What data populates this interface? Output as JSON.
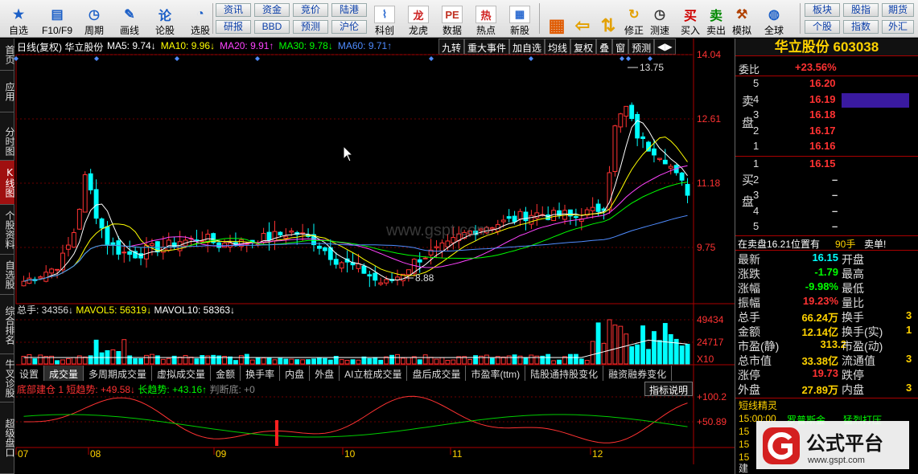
{
  "toolbar": {
    "items": [
      {
        "label": "自选",
        "icon": "star-icon"
      },
      {
        "label": "F10/F9",
        "icon": "f10-icon"
      },
      {
        "label": "周期",
        "icon": "clock-icon"
      },
      {
        "label": "画线",
        "icon": "pen-icon"
      },
      {
        "label": "论股",
        "icon": "discuss-icon"
      },
      {
        "label": "选股",
        "icon": "select-stock-icon"
      }
    ],
    "grid_buttons": [
      [
        "资讯",
        "资金",
        "竞价",
        "陆港"
      ],
      [
        "研报",
        "BBD",
        "预测",
        "沪伦"
      ]
    ],
    "items2": [
      {
        "label": "科创",
        "icon": "kechuang-icon"
      },
      {
        "label": "龙虎",
        "icon": "dragon-tiger-icon"
      },
      {
        "label": "数据",
        "icon": "data-pe-icon"
      },
      {
        "label": "热点",
        "icon": "hot-icon"
      },
      {
        "label": "新股",
        "icon": "new-stock-icon"
      }
    ],
    "items3": [
      {
        "label": "",
        "icon": "grid-icon"
      },
      {
        "label": "",
        "icon": "back-arrow-icon"
      },
      {
        "label": "",
        "icon": "up-down-icon"
      },
      {
        "label": "修正",
        "icon": "fix-icon"
      },
      {
        "label": "测速",
        "icon": "speed-icon"
      },
      {
        "label": "买入",
        "icon": "buy-icon"
      },
      {
        "label": "卖出",
        "icon": "sell-icon"
      },
      {
        "label": "模拟",
        "icon": "simulate-icon"
      },
      {
        "label": "全球",
        "icon": "globe-icon"
      }
    ],
    "grid_buttons2": [
      [
        "板块",
        "股指",
        "期货"
      ],
      [
        "个股",
        "指数",
        "外汇"
      ]
    ]
  },
  "left_tabs": [
    "首页",
    "应用",
    "分时图",
    "K线图",
    "个股资料",
    "自选股",
    "综合排名",
    "牛叉诊股",
    "超级盘口"
  ],
  "chart": {
    "title": "日线(复权)",
    "stock": "华立股份",
    "ma": [
      {
        "label": "MA5: 9.74↓",
        "color": "#ffffff"
      },
      {
        "label": "MA10: 9.96↓",
        "color": "#ffff00"
      },
      {
        "label": "MA20: 9.91↑",
        "color": "#ff44ff"
      },
      {
        "label": "MA30: 9.78↓",
        "color": "#00ff00"
      },
      {
        "label": "MA60: 9.71↑",
        "color": "#4f8cff"
      }
    ],
    "right_buttons": [
      "九转",
      "重大事件",
      "加自选",
      "均线",
      "复权",
      "叠",
      "窗",
      "预测",
      "◀▶"
    ],
    "y_labels": [
      "14.04",
      "12.61",
      "11.18",
      "9.75"
    ],
    "high_label": "13.75",
    "low_label": "8.88",
    "watermark": "www.gspt.com",
    "x_labels": [
      "07",
      "08",
      "09",
      "10",
      "11",
      "12"
    ],
    "volume_header": {
      "total": "总手: 34356↓",
      "mavol5": "MAVOL5: 56319↓",
      "mavol10": "MAVOL10: 58363↓"
    },
    "volume_labels": [
      "49434",
      "24717",
      "X10"
    ],
    "indicator_header": {
      "name": "底部建仓",
      "short": "1 短趋势: +49.58↓",
      "long": "长趋势: +43.16↑",
      "judge": "判断底: +0"
    },
    "indicator_btn": "指标说明",
    "indicator_labels": [
      "+100.2",
      "+50.89"
    ]
  },
  "bottom_tabs": [
    "设置",
    "成交量",
    "多周期成交量",
    "虚拟成交量",
    "金额",
    "换手率",
    "内盘",
    "外盘",
    "AI立桩成交量",
    "盘后成交量",
    "市盈率(ttm)",
    "陆股通持股变化",
    "融资融券变化"
  ],
  "panel": {
    "title": "华立股份 603038",
    "weibi_label": "委比",
    "weibi": "+23.56%",
    "sell_label": "卖盘",
    "buy_label": "买盘",
    "sell": [
      [
        "5",
        "16.20"
      ],
      [
        "4",
        "16.19"
      ],
      [
        "3",
        "16.18"
      ],
      [
        "2",
        "16.17"
      ],
      [
        "1",
        "16.16"
      ]
    ],
    "buy": [
      [
        "1",
        "16.15"
      ],
      [
        "2",
        "–"
      ],
      [
        "3",
        "–"
      ],
      [
        "4",
        "–"
      ],
      [
        "5",
        "–"
      ]
    ],
    "note": "在卖盘16.21位置有",
    "note_val": "90手",
    "note_tag": "卖单!",
    "stats_left": [
      [
        "最新",
        "16.15"
      ],
      [
        "涨跌",
        "-1.79"
      ],
      [
        "涨幅",
        "-9.98%"
      ],
      [
        "振幅",
        "19.23%"
      ],
      [
        "总手",
        "66.24万"
      ],
      [
        "金额",
        "12.14亿"
      ],
      [
        "市盈(静)",
        "313.2"
      ],
      [
        "总市值",
        "33.38亿"
      ],
      [
        "涨停",
        "19.73"
      ],
      [
        "外盘",
        "27.89万"
      ]
    ],
    "stats_right": [
      "开盘",
      "最高",
      "最低",
      "量比",
      "换手",
      "换手(实)",
      "市盈(动)",
      "流通值",
      "跌停",
      "内盘"
    ],
    "stats_right_vals": [
      "",
      "",
      "",
      "",
      "3",
      "1",
      "",
      "3",
      "",
      "3"
    ],
    "jingling": "短线精灵",
    "alerts": [
      [
        "15:00:00",
        "罗普斯金",
        "猛烈打压"
      ],
      [
        "15",
        "",
        ""
      ],
      [
        "15",
        "",
        ""
      ],
      [
        "15",
        "",
        ""
      ]
    ],
    "bottom_text": "建"
  },
  "logo": {
    "text": "公式平台",
    "url": "www.gspt.com"
  },
  "colors": {
    "up": "#ff3232",
    "down": "#00ffff",
    "grid": "#6b0000",
    "axis": "#aa0000"
  }
}
